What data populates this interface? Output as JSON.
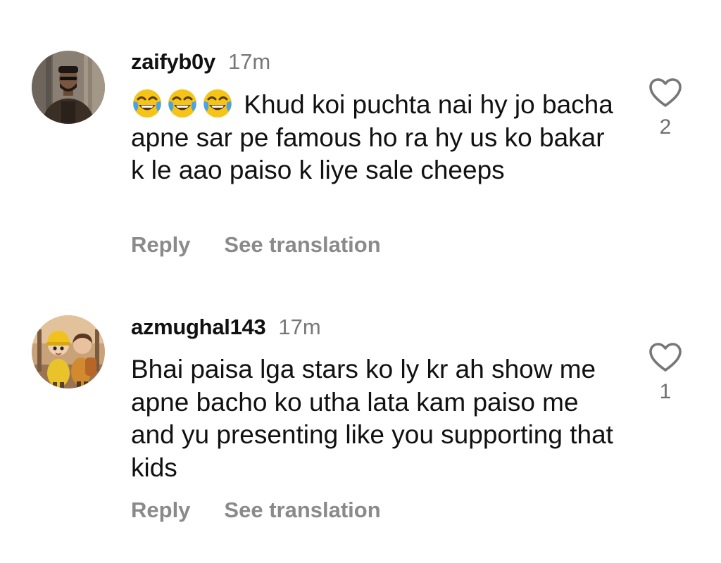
{
  "comments": [
    {
      "username": "zaifyb0y",
      "time": "17m",
      "emoji": "😂😂😂",
      "text": " Khud koi puchta nai hy jo bacha apne sar pe famous ho ra hy us ko bakar k le aao paiso k liye sale cheeps",
      "reply_label": "Reply",
      "translate_label": "See translation",
      "like_count": "2",
      "avatar_icon": "user-avatar-man-dark-jacket",
      "like_icon": "heart-outline-icon"
    },
    {
      "username": "azmughal143",
      "time": "17m",
      "text": "Bhai paisa lga stars ko ly kr ah show me apne bacho ko utha lata kam paiso me and yu presenting like you supporting that kids",
      "reply_label": "Reply",
      "translate_label": "See translation",
      "like_count": "1",
      "avatar_icon": "user-avatar-cartoon-kids",
      "like_icon": "heart-outline-icon"
    }
  ],
  "colors": {
    "username": "#111111",
    "timestamp": "#777777",
    "actions": "#8a8a8a",
    "heart": "#777777"
  }
}
